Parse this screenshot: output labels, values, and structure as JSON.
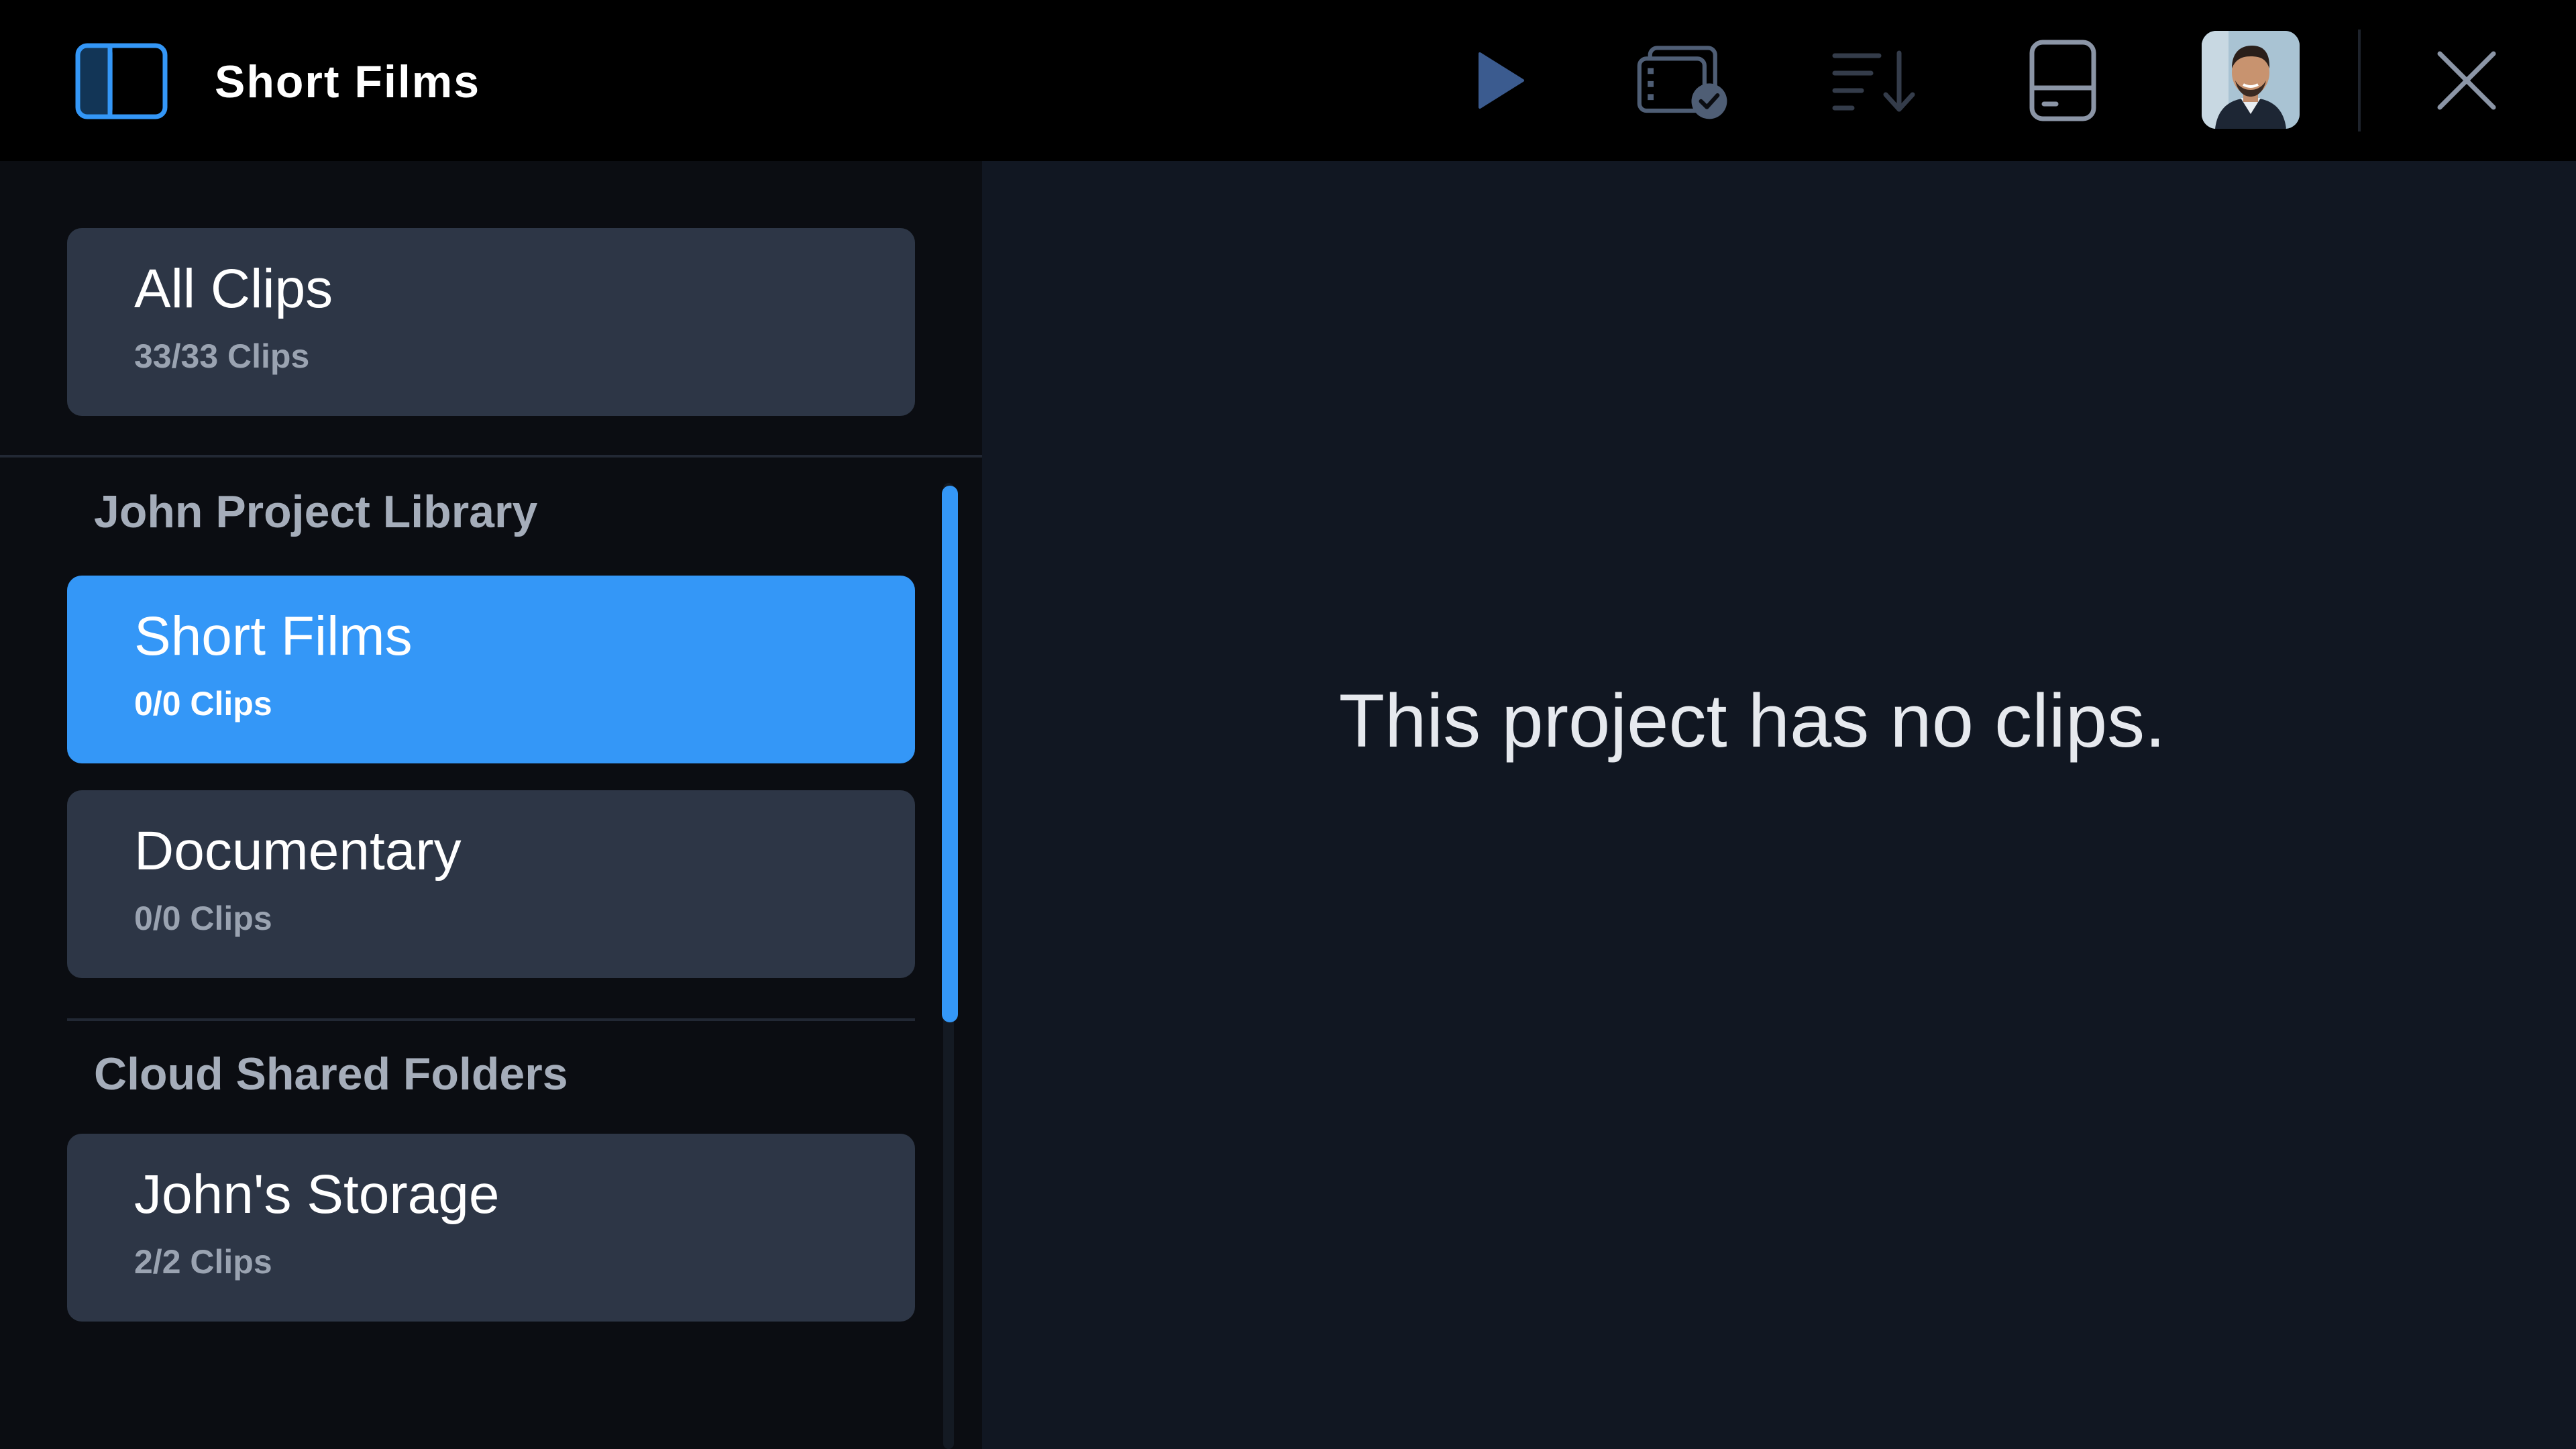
{
  "header": {
    "title": "Short Films",
    "icons": {
      "sidebar_toggle": "sidebar-toggle-icon",
      "play": "play-icon",
      "clips_select": "clips-check-icon",
      "sort": "sort-descending-icon",
      "drive": "drive-icon",
      "close": "close-icon"
    }
  },
  "sidebar": {
    "all_clips": {
      "label": "All Clips",
      "count": "33/33 Clips"
    },
    "sections": [
      {
        "title": "John Project Library",
        "items": [
          {
            "label": "Short Films",
            "count": "0/0 Clips",
            "active": true
          },
          {
            "label": "Documentary",
            "count": "0/0 Clips",
            "active": false
          }
        ]
      },
      {
        "title": "Cloud Shared Folders",
        "items": [
          {
            "label": "John's Storage",
            "count": "2/2 Clips",
            "active": false
          }
        ]
      }
    ]
  },
  "main": {
    "empty_message": "This project has no clips."
  },
  "colors": {
    "accent": "#3497f7",
    "header_bg": "#000000",
    "sidebar_bg": "#0b0d12",
    "card_bg": "#2d3646",
    "main_bg": "#111722"
  }
}
